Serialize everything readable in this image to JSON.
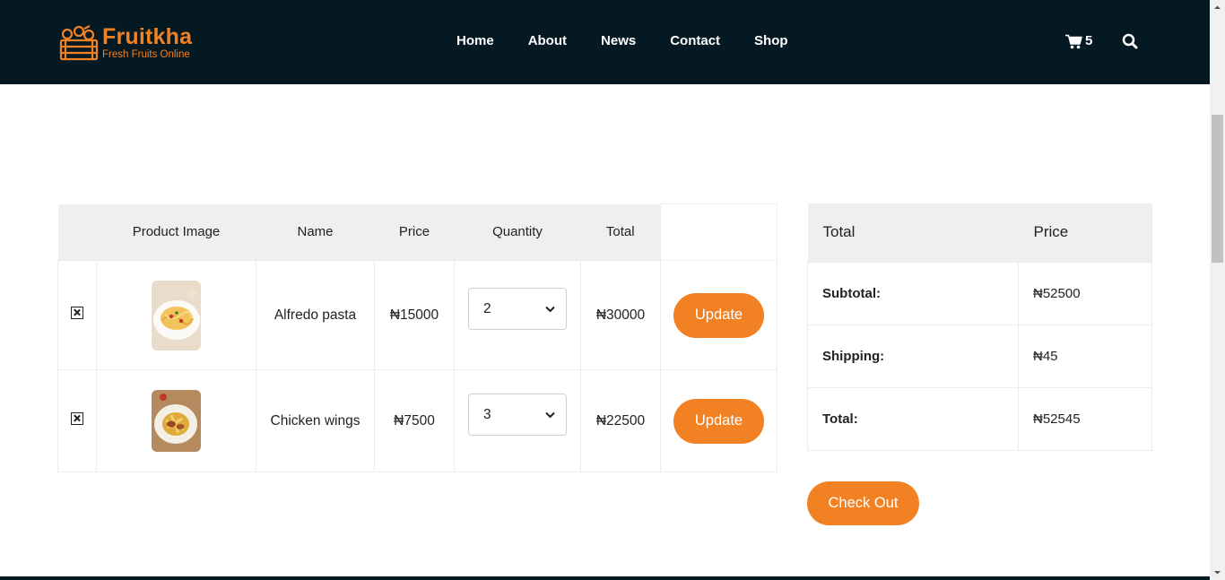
{
  "brand": {
    "name": "Fruitkha",
    "tagline": "Fresh Fruits Online",
    "accent_color": "#F28123",
    "header_bg": "#051922"
  },
  "nav": {
    "items": [
      "Home",
      "About",
      "News",
      "Contact",
      "Shop"
    ]
  },
  "cart": {
    "icon": "cart-icon",
    "count": "5"
  },
  "search": {
    "icon": "search-icon"
  },
  "cart_table": {
    "headers": [
      "Product Image",
      "Name",
      "Price",
      "Quantity",
      "Total"
    ],
    "rows": [
      {
        "name": "Alfredo pasta",
        "price": "₦15000",
        "quantity": "2",
        "total": "₦30000",
        "action": "Update",
        "image": "alfredo-pasta-photo"
      },
      {
        "name": "Chicken wings",
        "price": "₦7500",
        "quantity": "3",
        "total": "₦22500",
        "action": "Update",
        "image": "chicken-wings-photo"
      }
    ]
  },
  "totals": {
    "headers": [
      "Total",
      "Price"
    ],
    "rows": [
      {
        "label": "Subtotal:",
        "value": "₦52500"
      },
      {
        "label": "Shipping:",
        "value": "₦45"
      },
      {
        "label": "Total:",
        "value": "₦52545"
      }
    ]
  },
  "checkout": {
    "label": "Check Out"
  }
}
